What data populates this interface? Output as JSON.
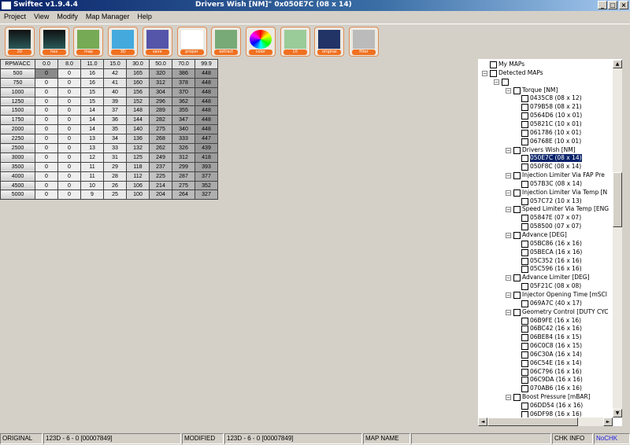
{
  "window": {
    "app_title": "Swiftec v1.9.4.4",
    "doc_title": "Drivers Wish [NM]\" 0x050E7C (08 x 14)"
  },
  "menu": [
    "Project",
    "View",
    "Modify",
    "Map Manager",
    "Help"
  ],
  "toolbar": [
    {
      "label": "2D",
      "icon": "wave-2d-icon"
    },
    {
      "label": "hex",
      "icon": "wave-hex-icon"
    },
    {
      "label": "map",
      "icon": "map-image-icon"
    },
    {
      "label": "3D",
      "icon": "shapes-3d-icon"
    },
    {
      "label": "save",
      "icon": "floppy-icon"
    },
    {
      "label": "proper",
      "icon": "pencil-icon"
    },
    {
      "label": "extract",
      "icon": "extract-arrow-icon"
    },
    {
      "label": "color",
      "icon": "color-wheel-icon"
    },
    {
      "label": "10",
      "icon": "calculator-icon"
    },
    {
      "label": "original",
      "icon": "original-icon"
    },
    {
      "label": "filter",
      "icon": "funnel-icon"
    }
  ],
  "table": {
    "corner": "RPM/ACC",
    "columns": [
      "0.0",
      "8.0",
      "11.0",
      "15.0",
      "30.0",
      "50.0",
      "70.0",
      "99.9"
    ],
    "rows": [
      {
        "rpm": "500",
        "v": [
          0,
          0,
          16,
          42,
          165,
          320,
          386,
          448
        ]
      },
      {
        "rpm": "750",
        "v": [
          0,
          0,
          16,
          41,
          160,
          312,
          378,
          448
        ]
      },
      {
        "rpm": "1000",
        "v": [
          0,
          0,
          15,
          40,
          156,
          304,
          370,
          448
        ]
      },
      {
        "rpm": "1250",
        "v": [
          0,
          0,
          15,
          39,
          152,
          296,
          362,
          448
        ]
      },
      {
        "rpm": "1500",
        "v": [
          0,
          0,
          14,
          37,
          148,
          289,
          355,
          448
        ]
      },
      {
        "rpm": "1750",
        "v": [
          0,
          0,
          14,
          36,
          144,
          282,
          347,
          448
        ]
      },
      {
        "rpm": "2000",
        "v": [
          0,
          0,
          14,
          35,
          140,
          275,
          340,
          448
        ]
      },
      {
        "rpm": "2250",
        "v": [
          0,
          0,
          13,
          34,
          136,
          268,
          333,
          447
        ]
      },
      {
        "rpm": "2500",
        "v": [
          0,
          0,
          13,
          33,
          132,
          262,
          326,
          439
        ]
      },
      {
        "rpm": "3000",
        "v": [
          0,
          0,
          12,
          31,
          125,
          249,
          312,
          418
        ]
      },
      {
        "rpm": "3500",
        "v": [
          0,
          0,
          11,
          29,
          118,
          237,
          299,
          393
        ]
      },
      {
        "rpm": "4000",
        "v": [
          0,
          0,
          11,
          28,
          112,
          225,
          287,
          377
        ]
      },
      {
        "rpm": "4500",
        "v": [
          0,
          0,
          10,
          26,
          106,
          214,
          275,
          352
        ]
      },
      {
        "rpm": "5000",
        "v": [
          0,
          0,
          9,
          25,
          100,
          204,
          264,
          327
        ]
      }
    ],
    "selected_cell": [
      0,
      0
    ]
  },
  "tree": [
    {
      "d": 0,
      "t": "My MAPs",
      "e": false
    },
    {
      "d": 0,
      "t": "Detected MAPs",
      "e": true
    },
    {
      "d": 1,
      "t": "",
      "e": true
    },
    {
      "d": 2,
      "t": "Torque [NM]",
      "e": true
    },
    {
      "d": 3,
      "t": "0435C8 (08 x 12)"
    },
    {
      "d": 3,
      "t": "079B58 (08 x 21)"
    },
    {
      "d": 3,
      "t": "0564D6 (10 x 01)"
    },
    {
      "d": 3,
      "t": "05821C (10 x 01)"
    },
    {
      "d": 3,
      "t": "061786 (10 x 01)"
    },
    {
      "d": 3,
      "t": "06768E (10 x 01)"
    },
    {
      "d": 2,
      "t": "Drivers Wish [NM]",
      "e": true
    },
    {
      "d": 3,
      "t": "050E7C (08 x 14)",
      "sel": true
    },
    {
      "d": 3,
      "t": "050F8C (08 x 14)"
    },
    {
      "d": 2,
      "t": "Injection Limiter Via FAP Pre",
      "e": true
    },
    {
      "d": 3,
      "t": "057B3C (08 x 14)"
    },
    {
      "d": 2,
      "t": "Injection Limiter Via Temp [N",
      "e": true
    },
    {
      "d": 3,
      "t": "057C72 (10 x 13)"
    },
    {
      "d": 2,
      "t": "Speed Limiter Via Temp [ENG",
      "e": true
    },
    {
      "d": 3,
      "t": "05847E (07 x 07)"
    },
    {
      "d": 3,
      "t": "058500 (07 x 07)"
    },
    {
      "d": 2,
      "t": "Advance [DEG]",
      "e": true
    },
    {
      "d": 3,
      "t": "05BC86 (16 x 16)"
    },
    {
      "d": 3,
      "t": "05BECA (16 x 16)"
    },
    {
      "d": 3,
      "t": "05C352 (16 x 16)"
    },
    {
      "d": 3,
      "t": "05C596 (16 x 16)"
    },
    {
      "d": 2,
      "t": "Advance Limiter [DEG]",
      "e": true
    },
    {
      "d": 3,
      "t": "05F21C (08 x 08)"
    },
    {
      "d": 2,
      "t": "Injector Opening Time [mSCI",
      "e": true
    },
    {
      "d": 3,
      "t": "069A7C (40 x 17)"
    },
    {
      "d": 2,
      "t": "Geometry Control [DUTY CYC",
      "e": true
    },
    {
      "d": 3,
      "t": "06B9FE (16 x 16)"
    },
    {
      "d": 3,
      "t": "06BC42 (16 x 16)"
    },
    {
      "d": 3,
      "t": "06BE84 (16 x 15)"
    },
    {
      "d": 3,
      "t": "06C0C8 (16 x 15)"
    },
    {
      "d": 3,
      "t": "06C30A (16 x 14)"
    },
    {
      "d": 3,
      "t": "06C54E (16 x 14)"
    },
    {
      "d": 3,
      "t": "06C796 (16 x 16)"
    },
    {
      "d": 3,
      "t": "06C9DA (16 x 16)"
    },
    {
      "d": 3,
      "t": "070AB6 (16 x 16)"
    },
    {
      "d": 2,
      "t": "Boost Pressure [mBAR]",
      "e": true
    },
    {
      "d": 3,
      "t": "06DD54 (16 x 16)"
    },
    {
      "d": 3,
      "t": "06DF98 (16 x 16)"
    }
  ],
  "status": {
    "original_label": "ORIGINAL",
    "original_value": "123D - 6 - 0 [00007849]",
    "modified_label": "MODIFIED",
    "modified_value": "123D - 6 - 0 [00007849]",
    "map_name_label": "MAP NAME",
    "map_name_value": "",
    "chk_label": "CHK INFO",
    "chk_value": "NoCHK"
  },
  "colors": {
    "title_start": "#0a246a",
    "toolbar_accent": "#f07020",
    "selection": "#0a246a",
    "nochk": "#2020e0"
  }
}
